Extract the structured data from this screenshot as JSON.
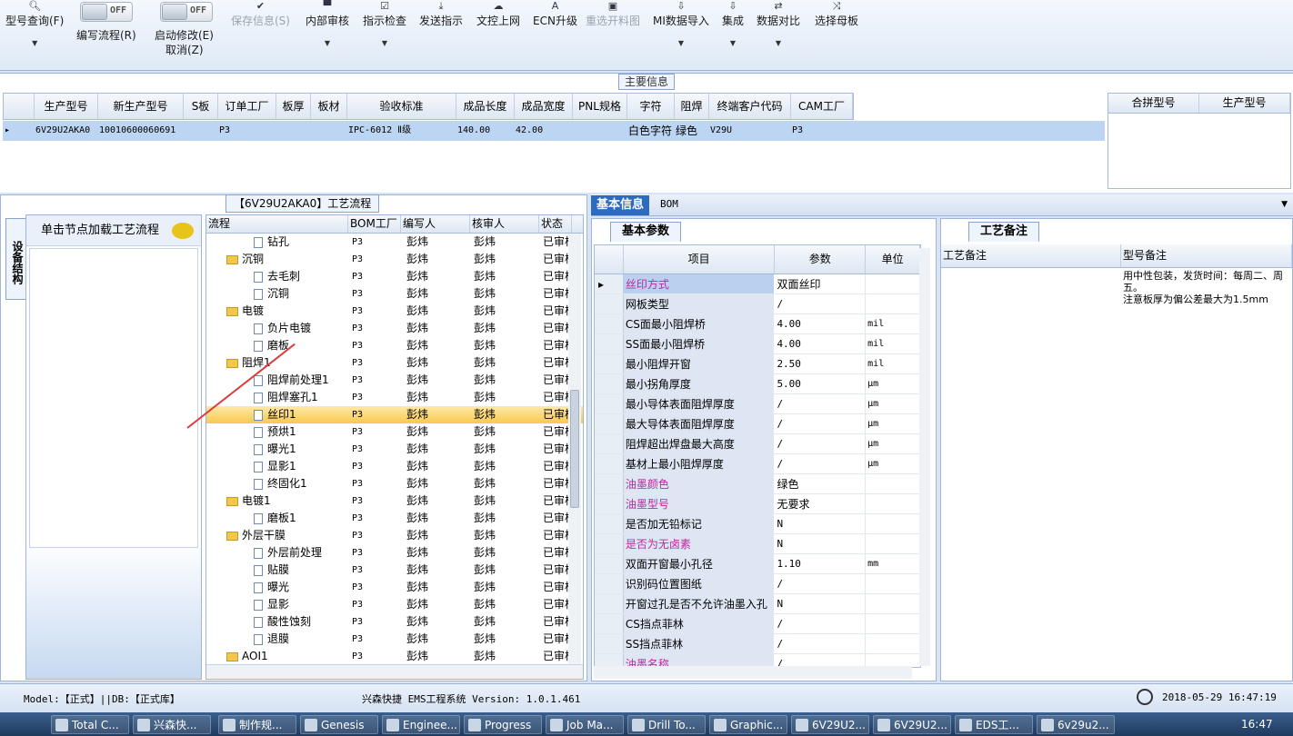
{
  "toolbar": {
    "model_query": "型号查询(F)",
    "write_flow": "编写流程(R)",
    "start_modify": "启动修改(E)",
    "cancel": "取消(Z)",
    "save_info": "保存信息(S)",
    "internal_review": "内部审核",
    "indicator_check": "指示检查",
    "send_indicator": "发送指示",
    "file_upload": "文控上网",
    "ecn_upgrade": "ECN升级",
    "reselect_cutting": "重选开料图",
    "mi_import": "MI数据导入",
    "integrate": "集成",
    "data_compare": "数据对比",
    "select_master": "选择母板",
    "toggle_off": "OFF"
  },
  "main_info": {
    "title": "主要信息",
    "columns": [
      "生产型号",
      "新生产型号",
      "S板",
      "订单工厂",
      "板厚",
      "板材",
      "验收标准",
      "成品长度",
      "成品宽度",
      "PNL规格",
      "字符",
      "阻焊",
      "终端客户代码",
      "CAM工厂"
    ],
    "row": [
      "6V29U2AKA0",
      "10010600060691",
      "",
      "P3",
      "",
      "",
      "IPC-6012 Ⅱ级",
      "140.00",
      "42.00",
      "",
      "白色字符",
      "绿色",
      "V29U",
      "P3"
    ],
    "side_columns": [
      "合拼型号",
      "生产型号"
    ]
  },
  "left": {
    "vtab": "设备结构",
    "node_hint": "单击节点加载工艺流程",
    "flow_title": "【6V29U2AKA0】工艺流程",
    "flow_columns": [
      "流程",
      "BOM工厂",
      "编写人",
      "核审人",
      "状态"
    ],
    "flow_rows": [
      {
        "name": "钻孔",
        "type": "doc",
        "level": 2,
        "bom": "P3",
        "writer": "彭炜",
        "reviewer": "彭炜",
        "status": "已审核"
      },
      {
        "name": "沉铜",
        "type": "folder",
        "level": 1,
        "bom": "P3",
        "writer": "彭炜",
        "reviewer": "彭炜",
        "status": "已审核"
      },
      {
        "name": "去毛刺",
        "type": "doc",
        "level": 2,
        "bom": "P3",
        "writer": "彭炜",
        "reviewer": "彭炜",
        "status": "已审核"
      },
      {
        "name": "沉铜",
        "type": "doc",
        "level": 2,
        "bom": "P3",
        "writer": "彭炜",
        "reviewer": "彭炜",
        "status": "已审核"
      },
      {
        "name": "电镀",
        "type": "folder",
        "level": 1,
        "bom": "P3",
        "writer": "彭炜",
        "reviewer": "彭炜",
        "status": "已审核"
      },
      {
        "name": "负片电镀",
        "type": "doc",
        "level": 2,
        "bom": "P3",
        "writer": "彭炜",
        "reviewer": "彭炜",
        "status": "已审核"
      },
      {
        "name": "磨板",
        "type": "doc",
        "level": 2,
        "bom": "P3",
        "writer": "彭炜",
        "reviewer": "彭炜",
        "status": "已审核"
      },
      {
        "name": "阻焊1",
        "type": "folder",
        "level": 1,
        "bom": "P3",
        "writer": "彭炜",
        "reviewer": "彭炜",
        "status": "已审核"
      },
      {
        "name": "阻焊前处理1",
        "type": "doc",
        "level": 2,
        "bom": "P3",
        "writer": "彭炜",
        "reviewer": "彭炜",
        "status": "已审核"
      },
      {
        "name": "阻焊塞孔1",
        "type": "doc",
        "level": 2,
        "bom": "P3",
        "writer": "彭炜",
        "reviewer": "彭炜",
        "status": "已审核"
      },
      {
        "name": "丝印1",
        "type": "doc",
        "level": 2,
        "bom": "P3",
        "writer": "彭炜",
        "reviewer": "彭炜",
        "status": "已审核",
        "selected": true
      },
      {
        "name": "预烘1",
        "type": "doc",
        "level": 2,
        "bom": "P3",
        "writer": "彭炜",
        "reviewer": "彭炜",
        "status": "已审核"
      },
      {
        "name": "曝光1",
        "type": "doc",
        "level": 2,
        "bom": "P3",
        "writer": "彭炜",
        "reviewer": "彭炜",
        "status": "已审核"
      },
      {
        "name": "显影1",
        "type": "doc",
        "level": 2,
        "bom": "P3",
        "writer": "彭炜",
        "reviewer": "彭炜",
        "status": "已审核"
      },
      {
        "name": "终固化1",
        "type": "doc",
        "level": 2,
        "bom": "P3",
        "writer": "彭炜",
        "reviewer": "彭炜",
        "status": "已审核"
      },
      {
        "name": "电镀1",
        "type": "folder",
        "level": 1,
        "bom": "P3",
        "writer": "彭炜",
        "reviewer": "彭炜",
        "status": "已审核"
      },
      {
        "name": "磨板1",
        "type": "doc",
        "level": 2,
        "bom": "P3",
        "writer": "彭炜",
        "reviewer": "彭炜",
        "status": "已审核"
      },
      {
        "name": "外层干膜",
        "type": "folder",
        "level": 1,
        "bom": "P3",
        "writer": "彭炜",
        "reviewer": "彭炜",
        "status": "已审核"
      },
      {
        "name": "外层前处理",
        "type": "doc",
        "level": 2,
        "bom": "P3",
        "writer": "彭炜",
        "reviewer": "彭炜",
        "status": "已审核"
      },
      {
        "name": "贴膜",
        "type": "doc",
        "level": 2,
        "bom": "P3",
        "writer": "彭炜",
        "reviewer": "彭炜",
        "status": "已审核"
      },
      {
        "name": "曝光",
        "type": "doc",
        "level": 2,
        "bom": "P3",
        "writer": "彭炜",
        "reviewer": "彭炜",
        "status": "已审核"
      },
      {
        "name": "显影",
        "type": "doc",
        "level": 2,
        "bom": "P3",
        "writer": "彭炜",
        "reviewer": "彭炜",
        "status": "已审核"
      },
      {
        "name": "酸性蚀刻",
        "type": "doc",
        "level": 2,
        "bom": "P3",
        "writer": "彭炜",
        "reviewer": "彭炜",
        "status": "已审核"
      },
      {
        "name": "退膜",
        "type": "doc",
        "level": 2,
        "bom": "P3",
        "writer": "彭炜",
        "reviewer": "彭炜",
        "status": "已审核"
      },
      {
        "name": "AOI1",
        "type": "folder",
        "level": 1,
        "bom": "P3",
        "writer": "彭炜",
        "reviewer": "彭炜",
        "status": "已审核"
      }
    ]
  },
  "right": {
    "tab_basic": "基本信息",
    "tab_bom": "BOM",
    "subtab_params": "基本参数",
    "param_columns": [
      "项目",
      "参数",
      "单位"
    ],
    "params": [
      {
        "item": "丝印方式",
        "value": "双面丝印",
        "unit": "",
        "magenta": true,
        "selected": true
      },
      {
        "item": "网板类型",
        "value": "/",
        "unit": ""
      },
      {
        "item": "CS面最小阻焊桥",
        "value": "4.00",
        "unit": "mil"
      },
      {
        "item": "SS面最小阻焊桥",
        "value": "4.00",
        "unit": "mil"
      },
      {
        "item": "最小阻焊开窗",
        "value": "2.50",
        "unit": "mil"
      },
      {
        "item": "最小拐角厚度",
        "value": "5.00",
        "unit": "μm"
      },
      {
        "item": "最小导体表面阻焊厚度",
        "value": "/",
        "unit": "μm"
      },
      {
        "item": "最大导体表面阻焊厚度",
        "value": "/",
        "unit": "μm"
      },
      {
        "item": "阻焊超出焊盘最大高度",
        "value": "/",
        "unit": "μm"
      },
      {
        "item": "基材上最小阻焊厚度",
        "value": "/",
        "unit": "μm"
      },
      {
        "item": "油墨颜色",
        "value": "绿色",
        "unit": "",
        "magenta": true
      },
      {
        "item": "油墨型号",
        "value": "无要求",
        "unit": "",
        "magenta": true
      },
      {
        "item": "是否加无铅标记",
        "value": "N",
        "unit": ""
      },
      {
        "item": "是否为无卤素",
        "value": "N",
        "unit": "",
        "magenta": true
      },
      {
        "item": "双面开窗最小孔径",
        "value": "1.10",
        "unit": "mm"
      },
      {
        "item": "识别码位置图纸",
        "value": "/",
        "unit": ""
      },
      {
        "item": "开窗过孔是否不允许油墨入孔",
        "value": "N",
        "unit": ""
      },
      {
        "item": "CS挡点菲林",
        "value": "/",
        "unit": ""
      },
      {
        "item": "SS挡点菲林",
        "value": "/",
        "unit": ""
      },
      {
        "item": "油墨名称",
        "value": "/",
        "unit": "",
        "magenta": true
      }
    ],
    "subtab_notes": "工艺备注",
    "note_columns": [
      "工艺备注",
      "型号备注"
    ],
    "model_note": "用中性包装，发货时间：每周二、周五。\n注意板厚为偏公差最大为1.5mm"
  },
  "status": {
    "model": "Model:【正式】||DB:【正式库】",
    "system": "兴森快捷 EMS工程系统 Version: 1.0.1.461",
    "datetime": "2018-05-29 16:47:19"
  },
  "taskbar": {
    "items": [
      "Total C...",
      "兴森快...",
      "制作规...",
      "Genesis",
      "Enginee...",
      "Progress",
      "Job Ma...",
      "Drill To...",
      "Graphic...",
      "6V29U2...",
      "6V29U2...",
      "EDS工...",
      "6v29u2..."
    ],
    "clock": "16:47"
  }
}
